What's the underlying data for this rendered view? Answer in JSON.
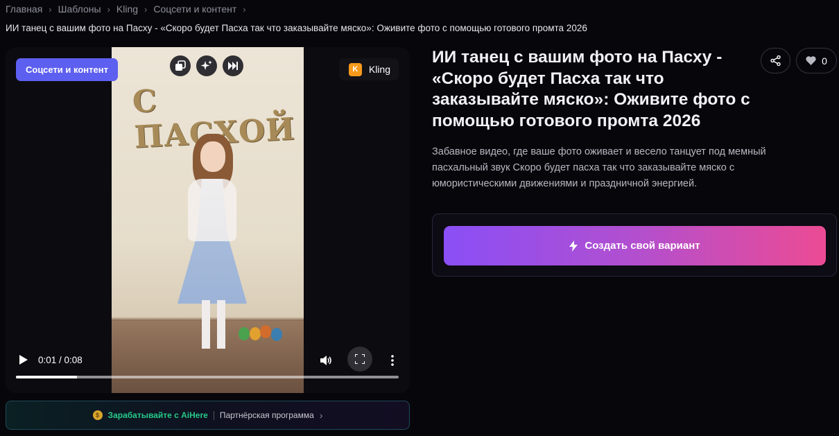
{
  "breadcrumb": [
    "Главная",
    "Шаблоны",
    "Kling",
    "Соцсети и контент"
  ],
  "subtitle": "ИИ танец с вашим фото на Пасху - «Скоро будет Пасха так что заказывайте мяско»: Оживите фото с помощью готового промта 2026",
  "video": {
    "category_tag": "Соцсети и контент",
    "model_name": "Kling",
    "model_logo_letter": "K",
    "scene_text": "С ПАСХОЙ",
    "time": "0:01 / 0:08",
    "progress": 0.16,
    "icons": [
      "copy-icon",
      "sparkles-icon",
      "skip-forward-icon"
    ]
  },
  "affiliate": {
    "earn_label": "Зарабатывайте с AiHere",
    "program_label": "Партнёрская программа"
  },
  "detail": {
    "title": "ИИ танец с вашим фото на Пасху - «Скоро будет Пасха так что заказывайте мяско»: Оживите фото с помощью готового промта 2026",
    "like_count": "0",
    "description": "Забавное видео, где ваше фото оживает и весело танцует под мемный пасхальный звук Скоро будет пасха так что заказывайте мяско с юмористическими движениями и праздничной энергией.",
    "create_label": "Создать свой вариант"
  },
  "colors": {
    "background": "#07070b",
    "tag": "#5d5ff0",
    "earn_text": "#27c98a",
    "create_gradient_start": "#8a4ff6",
    "create_gradient_end": "#ec4b93"
  }
}
